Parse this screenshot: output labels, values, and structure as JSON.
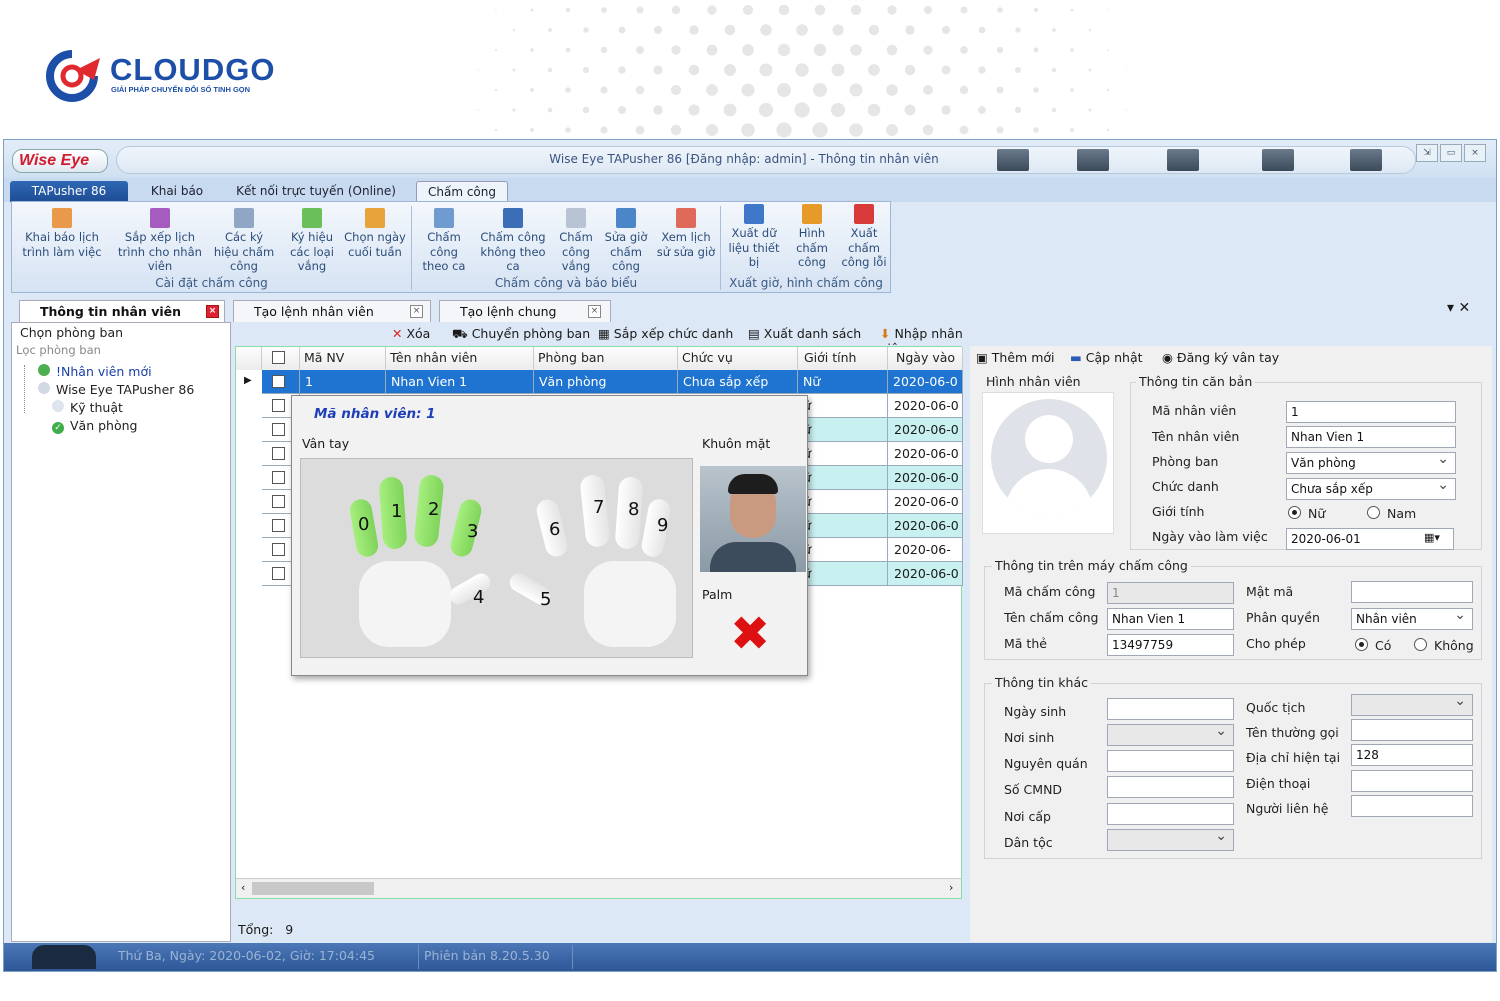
{
  "brand": {
    "name": "CLOUDGO",
    "tagline": "GIẢI PHÁP CHUYỂN ĐỔI SỐ TINH GỌN"
  },
  "window": {
    "logo": "Wise Eye",
    "title": "Wise Eye TAPusher 86 [Đăng nhập: admin] - Thông tin nhân viên"
  },
  "menu_tabs": [
    "TAPusher 86",
    "Khai báo",
    "Kết nối trực tuyến (Online)",
    "Chấm công"
  ],
  "ribbon": {
    "buttons": [
      {
        "label": "Khai báo lịch trình làm việc",
        "icon": "calendar-icon"
      },
      {
        "label": "Sắp xếp lịch trình cho nhân viên",
        "icon": "schedule-icon"
      },
      {
        "label": "Các ký hiệu chấm công",
        "icon": "symbol-icon"
      },
      {
        "label": "Ký hiệu các loại vắng",
        "icon": "absence-icon"
      },
      {
        "label": "Chọn ngày cuối tuần",
        "icon": "weekend-icon"
      },
      {
        "label": "Chấm công theo ca",
        "icon": "shift-icon"
      },
      {
        "label": "Chấm công không theo ca",
        "icon": "noshift-icon"
      },
      {
        "label": "Chấm công vắng",
        "icon": "absent-icon"
      },
      {
        "label": "Sửa giờ chấm công",
        "icon": "edit-time-icon"
      },
      {
        "label": "Xem lịch sử sửa giờ",
        "icon": "history-icon"
      },
      {
        "label": "Xuất dữ liệu thiết bị",
        "icon": "export-device-icon"
      },
      {
        "label": "Hình chấm công",
        "icon": "photo-icon"
      },
      {
        "label": "Xuất chấm công lỗi",
        "icon": "error-export-icon"
      }
    ],
    "groups": [
      "Cài đặt chấm công",
      "Chấm công và báo biểu",
      "Xuất giờ, hình chấm công"
    ]
  },
  "doc_tabs": [
    "Thông tin nhân viên",
    "Tạo lệnh nhân viên",
    "Tạo lệnh chung"
  ],
  "left_panel": {
    "header": "Chọn phòng ban",
    "filter": "Lọc phòng ban",
    "tree": [
      "!Nhân viên mới",
      "Wise Eye TAPusher 86",
      "Kỹ thuật",
      "Văn phòng"
    ]
  },
  "grid_toolbar": [
    "Xóa",
    "Chuyển phòng ban",
    "Sắp xếp chức danh",
    "Xuất danh sách",
    "Nhập nhân viên"
  ],
  "grid": {
    "columns": [
      "Mã NV",
      "Tên nhân viên",
      "Phòng ban",
      "Chức vụ",
      "Giới tính",
      "Ngày vào"
    ],
    "selected_row": {
      "ma_nv": "1",
      "ten": "Nhan Vien 1",
      "phong_ban": "Văn phòng",
      "chuc_vu": "Chưa sắp xếp",
      "gioi_tinh": "Nữ",
      "ngay_vao": "2020-06-0"
    },
    "other_rows": [
      {
        "gioi_tinh": "ữ",
        "ngay_vao": "2020-06-0"
      },
      {
        "gioi_tinh": "ữ",
        "ngay_vao": "2020-06-0"
      },
      {
        "gioi_tinh": "ữ",
        "ngay_vao": "2020-06-0"
      },
      {
        "gioi_tinh": "ữ",
        "ngay_vao": "2020-06-0"
      },
      {
        "gioi_tinh": "ữ",
        "ngay_vao": "2020-06-0"
      },
      {
        "gioi_tinh": "ữ",
        "ngay_vao": "2020-06-0"
      },
      {
        "gioi_tinh": "ữ",
        "ngay_vao": "2020-06-0:"
      },
      {
        "gioi_tinh": "ữ",
        "ngay_vao": "2020-06-0"
      }
    ],
    "total_label": "Tổng:",
    "total_value": "9"
  },
  "popup": {
    "title": "Mã nhân viên: 1",
    "fingerprint_label": "Vân tay",
    "face_label": "Khuôn mặt",
    "palm_label": "Palm",
    "finger_numbers": [
      "0",
      "1",
      "2",
      "3",
      "4",
      "5",
      "6",
      "7",
      "8",
      "9"
    ],
    "enrolled_fingers": [
      0,
      1,
      2,
      3
    ]
  },
  "right_toolbar": [
    "Thêm mới",
    "Cập nhật",
    "Đăng ký vân tay"
  ],
  "basic_info": {
    "photo_label": "Hình nhân viên",
    "section": "Thông tin căn bản",
    "fields": [
      {
        "label": "Mã nhân viên",
        "value": "1"
      },
      {
        "label": "Tên nhân viên",
        "value": "Nhan Vien 1"
      },
      {
        "label": "Phòng ban",
        "value": "Văn phòng"
      },
      {
        "label": "Chức danh",
        "value": "Chưa sắp xếp"
      }
    ],
    "gender_label": "Giới tính",
    "gender_options": [
      "Nữ",
      "Nam"
    ],
    "start_date_label": "Ngày vào làm việc",
    "start_date": "2020-06-01"
  },
  "device_info": {
    "section": "Thông tin trên máy chấm công",
    "ma_cham_cong_label": "Mã chấm công",
    "ma_cham_cong": "1",
    "ten_cham_cong_label": "Tên chấm công",
    "ten_cham_cong": "Nhan Vien 1",
    "ma_the_label": "Mã thẻ",
    "ma_the": "13497759",
    "mat_ma_label": "Mật mã",
    "mat_ma": "",
    "phan_quyen_label": "Phân quyền",
    "phan_quyen": "Nhân viên",
    "cho_phep_label": "Cho phép",
    "cho_phep_options": [
      "Có",
      "Không"
    ]
  },
  "other_info": {
    "section": "Thông tin khác",
    "left_labels": [
      "Ngày sinh",
      "Nơi sinh",
      "Nguyên quán",
      "Số CMND",
      "Nơi cấp",
      "Dân tộc"
    ],
    "right_labels": [
      "Quốc tịch",
      "Tên thường gọi",
      "Địa chỉ hiện tại",
      "Điện thoại",
      "Người liên hệ"
    ],
    "dia_chi": "128"
  },
  "status": {
    "datetime": "Thứ Ba, Ngày: 2020-06-02, Giờ: 17:04:45",
    "version": "Phiên bản 8.20.5.30"
  }
}
